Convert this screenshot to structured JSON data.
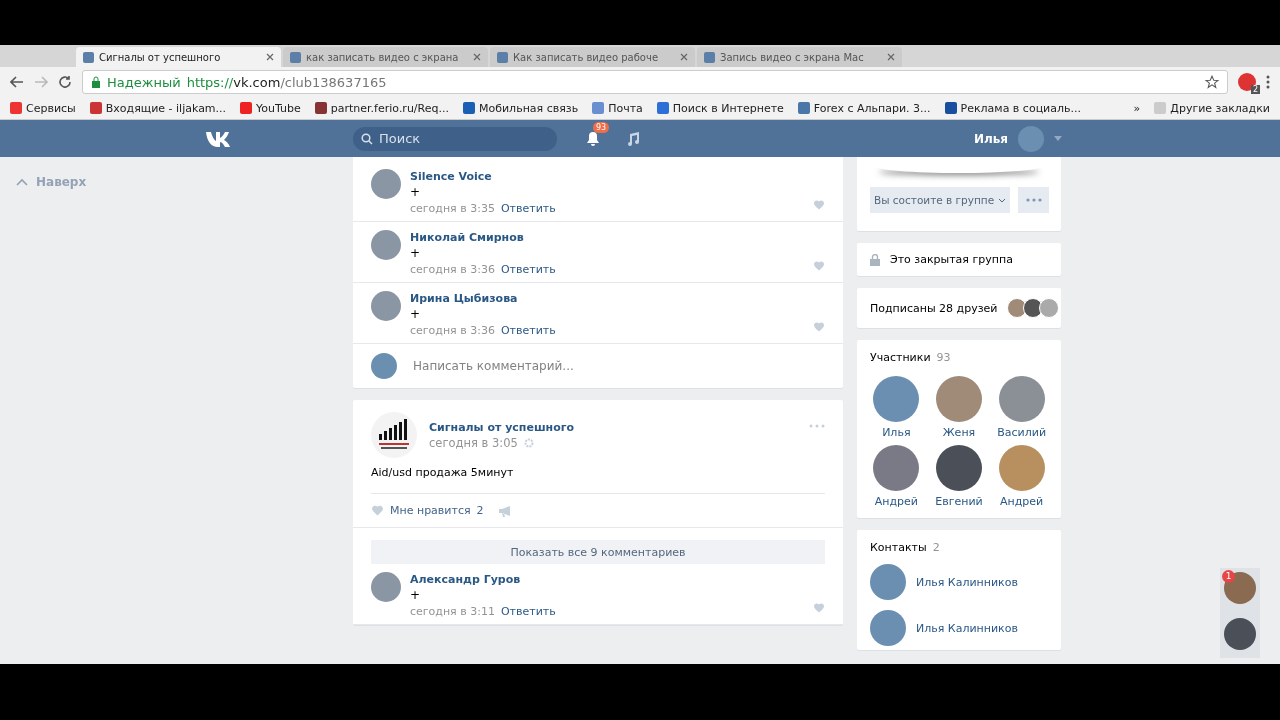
{
  "browser": {
    "tabs": [
      {
        "title": "Сигналы от успешного",
        "selected": true
      },
      {
        "title": "как записать видео с экрана",
        "selected": false
      },
      {
        "title": "Как записать видео рабоче",
        "selected": false
      },
      {
        "title": "Запись видео с экрана Mac",
        "selected": false
      }
    ],
    "secure_label": "Надежный",
    "url_scheme": "https://",
    "url_host": "vk.com",
    "url_path": "/club138637165",
    "extension_badge": "2",
    "bookmarks": [
      "Сервисы",
      "Входящие - iljakam...",
      "YouTube",
      "partner.ferio.ru/Req...",
      "Мобильная связь",
      "Почта",
      "Поиск в Интернете",
      "Forex с Альпари. 3...",
      "Реклама в социаль..."
    ],
    "more_bookmarks": "»",
    "other_bookmarks": "Другие закладки"
  },
  "header": {
    "search_placeholder": "Поиск",
    "notifications": "93",
    "user_name": "Илья"
  },
  "scroll_up": "Наверх",
  "comments": [
    {
      "author": "Silence Voice",
      "text": "+",
      "time": "сегодня в 3:35",
      "reply": "Ответить"
    },
    {
      "author": "Николай Смирнов",
      "text": "+",
      "time": "сегодня в 3:36",
      "reply": "Ответить"
    },
    {
      "author": "Ирина Цыбизова",
      "text": "+",
      "time": "сегодня в 3:36",
      "reply": "Ответить"
    }
  ],
  "comment_placeholder": "Написать комментарий...",
  "post": {
    "author": "Сигналы от успешного",
    "time": "сегодня в 3:05",
    "text": "Aid/usd продажа 5минут",
    "like_label": "Мне нравится",
    "like_count": "2",
    "show_all": "Показать все 9 комментариев",
    "comments": [
      {
        "author": "Александр Гуров",
        "text": "+",
        "time": "сегодня в 3:11",
        "reply": "Ответить"
      }
    ]
  },
  "group": {
    "membership": "Вы состоите в группе",
    "closed": "Это закрытая группа",
    "friends": "Подписаны 28 друзей",
    "members_title": "Участники",
    "members_count": "93",
    "members": [
      "Илья",
      "Женя",
      "Василий",
      "Андрей",
      "Евгений",
      "Андрей"
    ],
    "contacts_title": "Контакты",
    "contacts_count": "2",
    "contacts": [
      "Илья Калинников",
      "Илья Калинников"
    ]
  },
  "chat": {
    "unread": "1"
  }
}
